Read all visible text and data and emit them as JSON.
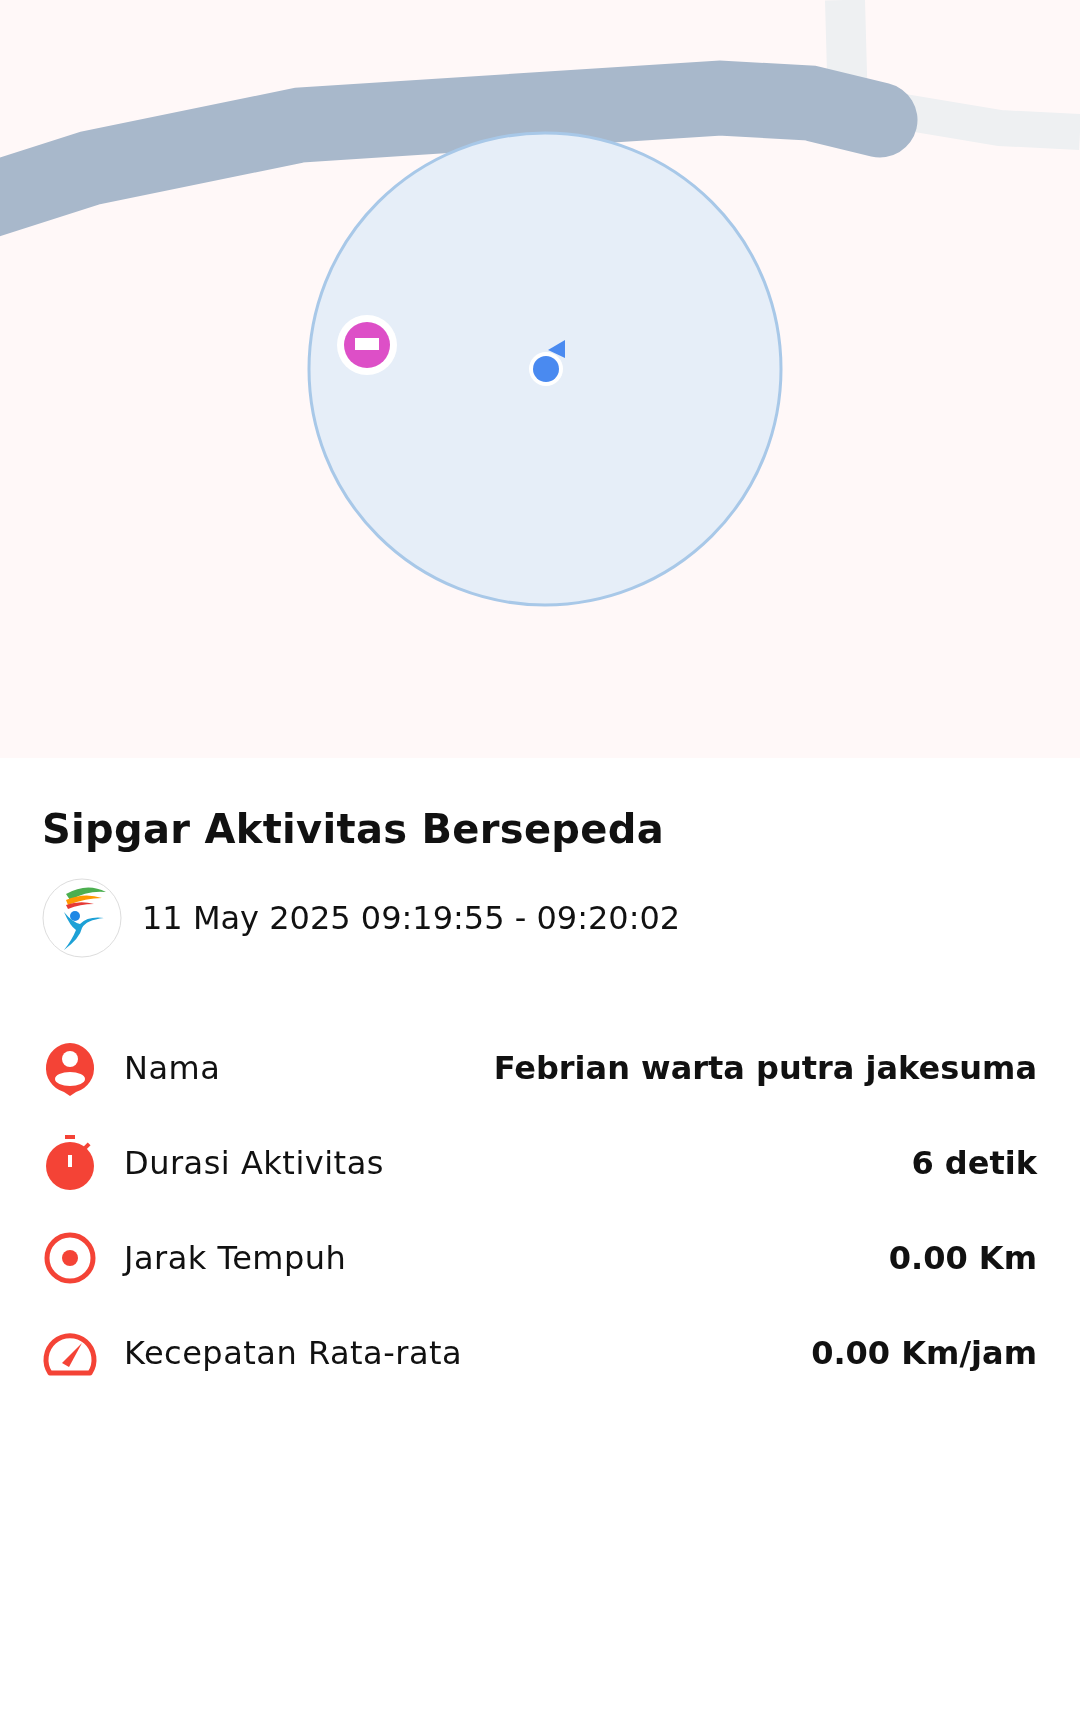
{
  "title": "Sipgar Aktivitas Bersepeda",
  "time_range": "11 May 2025 09:19:55 - 09:20:02",
  "stats": [
    {
      "kind": "person",
      "label": "Nama",
      "value": "Febrian warta putra jakesuma"
    },
    {
      "kind": "timer",
      "label": "Durasi Aktivitas",
      "value": "6 detik"
    },
    {
      "kind": "distance",
      "label": "Jarak Tempuh",
      "value": "0.00 Km"
    },
    {
      "kind": "speed",
      "label": "Kecepatan Rata-rata",
      "value": "0.00 Km/jam"
    }
  ]
}
